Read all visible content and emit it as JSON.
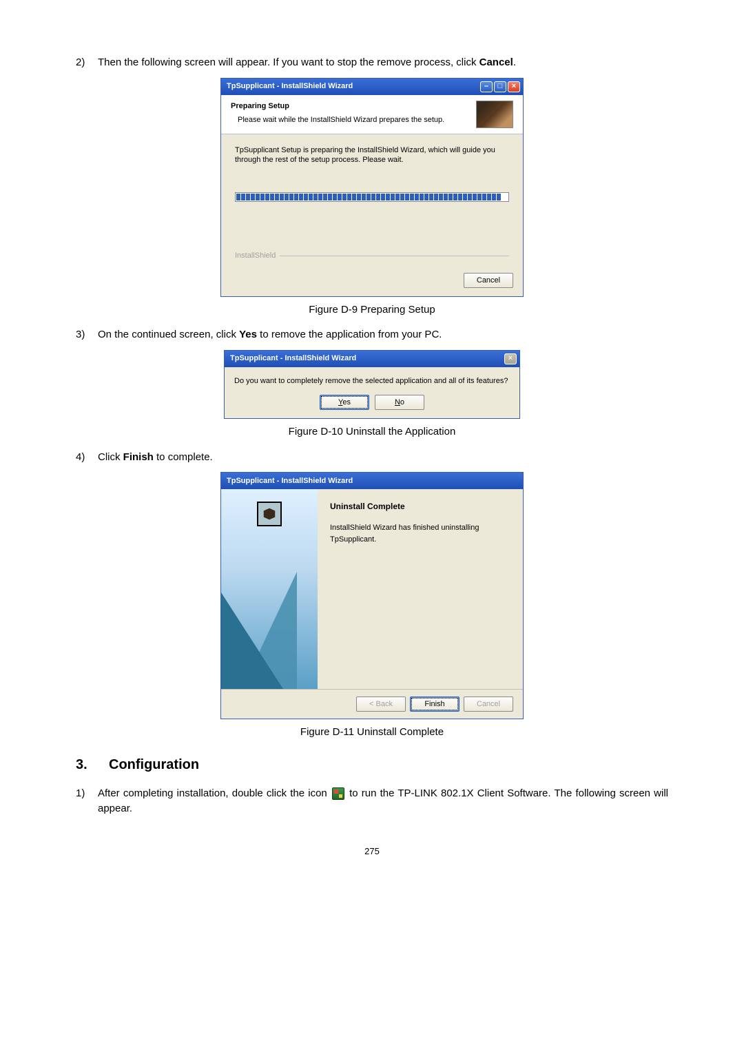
{
  "step2": {
    "num": "2)",
    "text_a": "Then the following screen will appear. If you want to stop the remove process, click ",
    "text_b": "Cancel",
    "text_c": "."
  },
  "dlg1": {
    "title": "TpSupplicant - InstallShield Wizard",
    "heading": "Preparing Setup",
    "subheading": "Please wait while the InstallShield Wizard prepares the setup.",
    "body": "TpSupplicant Setup is preparing the InstallShield Wizard, which will guide you through the rest of the setup process. Please wait.",
    "brand": "InstallShield",
    "cancel": "Cancel"
  },
  "caption1": "Figure D-9 Preparing Setup",
  "step3": {
    "num": "3)",
    "text_a": "On the continued screen, click ",
    "text_b": "Yes",
    "text_c": " to remove the application from your PC."
  },
  "dlg2": {
    "title": "TpSupplicant - InstallShield Wizard",
    "question": "Do you want to completely remove the selected application and all of its features?",
    "yes": "Yes",
    "no": "No"
  },
  "caption2": "Figure D-10 Uninstall the Application",
  "step4": {
    "num": "4)",
    "text_a": "Click ",
    "text_b": "Finish",
    "text_c": " to complete."
  },
  "dlg3": {
    "title": "TpSupplicant - InstallShield Wizard",
    "heading": "Uninstall Complete",
    "body": "InstallShield Wizard has finished uninstalling TpSupplicant.",
    "back": "< Back",
    "finish": "Finish",
    "cancel": "Cancel"
  },
  "caption3": "Figure D-11 Uninstall Complete",
  "section": {
    "num": "3.",
    "title": "Configuration"
  },
  "cfg1": {
    "num": "1)",
    "text_a": "After completing installation, double click the icon ",
    "text_b": " to run the TP-LINK 802.1X Client Software. The following screen will appear."
  },
  "page_number": "275"
}
